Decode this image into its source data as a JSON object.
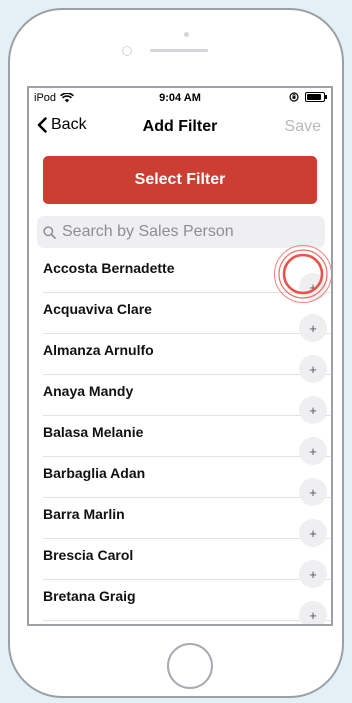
{
  "status_bar": {
    "carrier": "iPod",
    "time": "9:04 AM",
    "battery_percent": 90
  },
  "nav": {
    "back_label": "Back",
    "title": "Add Filter",
    "save_label": "Save"
  },
  "select_filter_label": "Select Filter",
  "search": {
    "placeholder": "Search by Sales Person"
  },
  "people": [
    {
      "name": "Accosta Bernadette",
      "action": "+"
    },
    {
      "name": "Acquaviva Clare",
      "action": "+"
    },
    {
      "name": "Almanza Arnulfo",
      "action": "+"
    },
    {
      "name": "Anaya Mandy",
      "action": "+"
    },
    {
      "name": "Balasa Melanie",
      "action": "+"
    },
    {
      "name": "Barbaglia Adan",
      "action": "+"
    },
    {
      "name": "Barra Marlin",
      "action": "+"
    },
    {
      "name": "Brescia Carol",
      "action": "+"
    },
    {
      "name": "Bretana Graig",
      "action": "+"
    }
  ],
  "colors": {
    "accent": "#cc3d32",
    "tap_highlight": "#e8534a",
    "background": "#e3f1f7"
  },
  "icons": [
    "wifi-icon",
    "chevron-left-icon",
    "search-icon",
    "lock-rotation-icon",
    "battery-icon",
    "plus-icon"
  ]
}
